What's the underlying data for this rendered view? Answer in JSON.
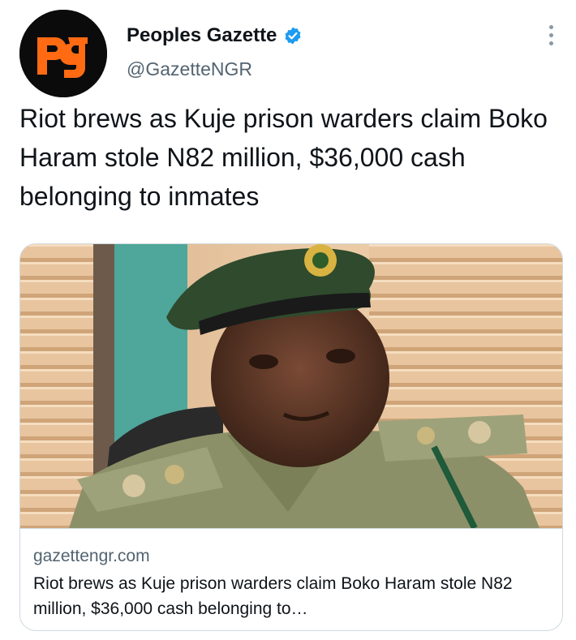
{
  "account": {
    "display_name": "Peoples Gazette",
    "handle": "@GazetteNGR",
    "avatar_text": "pg",
    "verified": true
  },
  "tweet": {
    "text": "Riot brews as Kuje prison warders claim Boko Haram stole N82 million, $36,000 cash belonging to inmates"
  },
  "card": {
    "domain": "gazettengr.com",
    "title": "Riot brews as Kuje prison warders claim Boko Haram stole N82 million, $36,000 cash belonging to…",
    "image_description": "portrait-of-prison-officer-in-green-beret-and-uniform"
  },
  "icons": {
    "more": "more-options-icon",
    "verified": "verified-badge-icon"
  },
  "colors": {
    "brand_orange": "#ff6a13",
    "verified_blue": "#1d9bf0",
    "text_primary": "#0f1419",
    "text_secondary": "#536471",
    "border": "#cfd9de"
  }
}
